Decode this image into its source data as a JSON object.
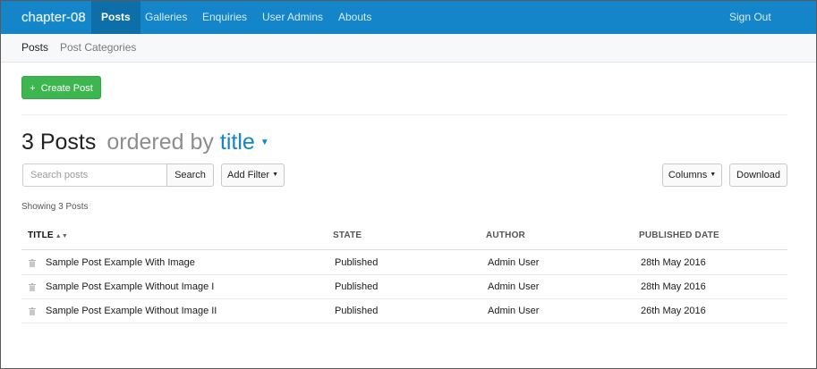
{
  "nav": {
    "brand": "chapter-08",
    "items": [
      {
        "label": "Posts",
        "active": true
      },
      {
        "label": "Galleries",
        "active": false
      },
      {
        "label": "Enquiries",
        "active": false
      },
      {
        "label": "User Admins",
        "active": false
      },
      {
        "label": "Abouts",
        "active": false
      }
    ],
    "sign_out": "Sign Out"
  },
  "subnav": {
    "items": [
      {
        "label": "Posts",
        "active": true
      },
      {
        "label": "Post Categories",
        "active": false
      }
    ]
  },
  "toolbar": {
    "create_label": "Create Post",
    "create_icon": "plus-icon"
  },
  "heading": {
    "count": "3 Posts",
    "ordered_by": "ordered by",
    "sort_field": "title"
  },
  "search": {
    "placeholder": "Search posts",
    "value": "",
    "button_label": "Search"
  },
  "filter": {
    "label": "Add Filter"
  },
  "columns": {
    "label": "Columns"
  },
  "download": {
    "label": "Download"
  },
  "showing": "Showing 3 Posts",
  "table": {
    "columns": [
      "TITLE",
      "STATE",
      "AUTHOR",
      "PUBLISHED DATE"
    ],
    "rows": [
      {
        "title": "Sample Post Example With Image",
        "state": "Published",
        "author": "Admin User",
        "date": "28th May 2016"
      },
      {
        "title": "Sample Post Example Without Image I",
        "state": "Published",
        "author": "Admin User",
        "date": "28th May 2016"
      },
      {
        "title": "Sample Post Example Without Image II",
        "state": "Published",
        "author": "Admin User",
        "date": "26th May 2016"
      }
    ]
  },
  "colors": {
    "nav_bg": "#1385c8",
    "nav_active_bg": "#0e6ea7",
    "create_button": "#3db650",
    "sort_field": "#1385c8"
  }
}
